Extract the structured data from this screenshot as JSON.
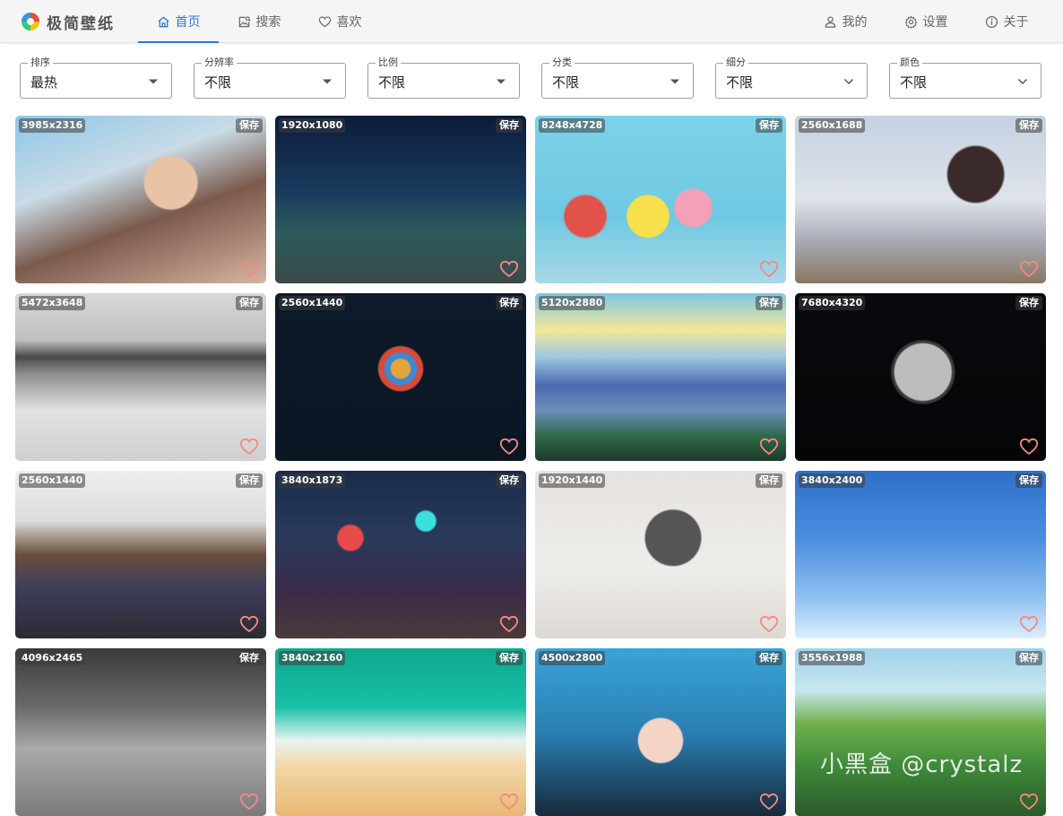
{
  "app": {
    "title": "极简壁纸"
  },
  "nav": [
    {
      "label": "首页",
      "icon": "home-icon"
    },
    {
      "label": "搜索",
      "icon": "image-search-icon"
    },
    {
      "label": "喜欢",
      "icon": "heart-outline-icon"
    }
  ],
  "user_nav": [
    {
      "label": "我的",
      "icon": "user-icon"
    },
    {
      "label": "设置",
      "icon": "gear-icon"
    },
    {
      "label": "关于",
      "icon": "info-icon"
    }
  ],
  "filters": [
    {
      "legend": "排序",
      "value": "最热"
    },
    {
      "legend": "分辨率",
      "value": "不限"
    },
    {
      "legend": "比例",
      "value": "不限"
    },
    {
      "legend": "分类",
      "value": "不限"
    },
    {
      "legend": "细分",
      "value": "不限"
    },
    {
      "legend": "颜色",
      "value": "不限"
    }
  ],
  "save_label": "保存",
  "wallpapers": [
    {
      "resolution": "3985x2316",
      "subject": "archer-girl"
    },
    {
      "resolution": "1920x1080",
      "subject": "night-street"
    },
    {
      "resolution": "8248x4728",
      "subject": "spongebob"
    },
    {
      "resolution": "2560x1688",
      "subject": "anime-girl-cup"
    },
    {
      "resolution": "5472x3648",
      "subject": "misty-mountains"
    },
    {
      "resolution": "2560x1440",
      "subject": "rubiks-cube"
    },
    {
      "resolution": "5120x2880",
      "subject": "river-valley"
    },
    {
      "resolution": "7680x4320",
      "subject": "moon"
    },
    {
      "resolution": "2560x1440",
      "subject": "overwatch"
    },
    {
      "resolution": "3840x1873",
      "subject": "cyberpunk-city"
    },
    {
      "resolution": "1920x1440",
      "subject": "sketch-girl"
    },
    {
      "resolution": "3840x2400",
      "subject": "blue-sky-poles"
    },
    {
      "resolution": "4096x2465",
      "subject": "temple-angel"
    },
    {
      "resolution": "3840x2160",
      "subject": "beach-waves"
    },
    {
      "resolution": "4500x2800",
      "subject": "miku"
    },
    {
      "resolution": "3556x1988",
      "subject": "green-landscape"
    }
  ],
  "watermark": "小黑盒 @crystalz",
  "colors": {
    "accent": "#2b7bd2",
    "heart": "#f28b82"
  }
}
